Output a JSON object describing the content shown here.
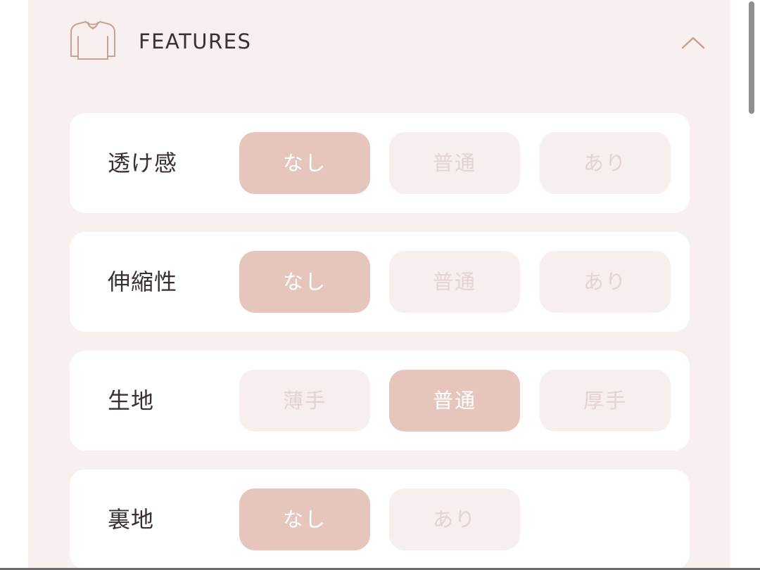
{
  "header": {
    "title": "FEATURES",
    "icon": "shirt-icon",
    "toggle_icon": "chevron-up-icon"
  },
  "colors": {
    "panel_bg": "#f7f0ef",
    "selected_bg": "#e6c5bd",
    "unselected_bg": "#f6efee",
    "unselected_text": "#e3d3d1",
    "icon_stroke": "#c9a095",
    "label_text": "#3a3030"
  },
  "features": [
    {
      "label": "透け感",
      "options": [
        {
          "label": "なし",
          "selected": true
        },
        {
          "label": "普通",
          "selected": false
        },
        {
          "label": "あり",
          "selected": false
        }
      ]
    },
    {
      "label": "伸縮性",
      "options": [
        {
          "label": "なし",
          "selected": true
        },
        {
          "label": "普通",
          "selected": false
        },
        {
          "label": "あり",
          "selected": false
        }
      ]
    },
    {
      "label": "生地",
      "options": [
        {
          "label": "薄手",
          "selected": false
        },
        {
          "label": "普通",
          "selected": true
        },
        {
          "label": "厚手",
          "selected": false
        }
      ]
    },
    {
      "label": "裏地",
      "options": [
        {
          "label": "なし",
          "selected": true
        },
        {
          "label": "あり",
          "selected": false
        }
      ]
    }
  ]
}
